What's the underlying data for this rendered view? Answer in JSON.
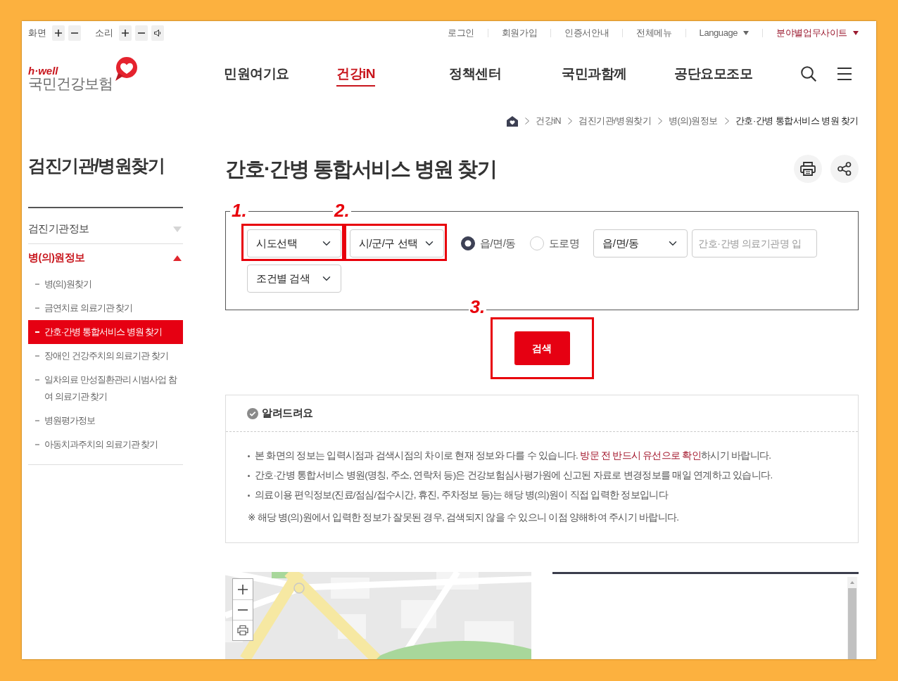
{
  "accessibility_bar": [
    {
      "label": "화면",
      "buttons": [
        {
          "kind": "increase"
        },
        {
          "kind": "decrease"
        }
      ]
    },
    {
      "label": "소리",
      "buttons": [
        {
          "kind": "increase"
        },
        {
          "kind": "decrease"
        },
        {
          "kind": "speaker"
        }
      ]
    }
  ],
  "utility_links": [
    {
      "label": "로그인",
      "dropdown": false,
      "emphasized": false
    },
    {
      "label": "회원가입",
      "dropdown": false,
      "emphasized": false
    },
    {
      "label": "인증서안내",
      "dropdown": false,
      "emphasized": false
    },
    {
      "label": "전체메뉴",
      "dropdown": false,
      "emphasized": false
    },
    {
      "label": "Language",
      "dropdown": true,
      "emphasized": false
    },
    {
      "label": "분야별업무사이트",
      "dropdown": true,
      "emphasized": true
    }
  ],
  "logo": {
    "tagline": "h·well",
    "name": "국민건강보험"
  },
  "nav": [
    {
      "label": "민원여기요",
      "selected": false
    },
    {
      "label": "건강iN",
      "selected": true
    },
    {
      "label": "정책센터",
      "selected": false
    },
    {
      "label": "국민과함께",
      "selected": false
    },
    {
      "label": "공단요모조모",
      "selected": false
    }
  ],
  "breadcrumb": [
    {
      "label": "건강iN",
      "current": false
    },
    {
      "label": "검진기관/병원찾기",
      "current": false
    },
    {
      "label": "병(의)원정보",
      "current": false
    },
    {
      "label": "간호·간병 통합서비스 병원 찾기",
      "current": true
    }
  ],
  "sidebar": {
    "title": "검진기관/병원찾기",
    "sections": [
      {
        "label": "검진기관정보",
        "expanded": false
      },
      {
        "label": "병(의)원정보",
        "expanded": true,
        "children": [
          {
            "label": "병(의)원찾기",
            "selected": false
          },
          {
            "label": "금연치료 의료기관 찾기",
            "selected": false
          },
          {
            "label": "간호·간병 통합서비스 병원 찾기",
            "selected": true
          },
          {
            "label": "장애인 건강주치의 의료기관 찾기",
            "selected": false
          },
          {
            "label": "일차의료 만성질환관리 시범사업 참여 의료기관 찾기",
            "selected": false
          },
          {
            "label": "병원평가정보",
            "selected": false
          },
          {
            "label": "아동치과주치의 의료기관 찾기",
            "selected": false
          }
        ]
      }
    ]
  },
  "page": {
    "title": "간호·간병 통합서비스 병원 찾기"
  },
  "search": {
    "filters": [
      {
        "kind": "select",
        "value": "시도선택",
        "step": "1."
      },
      {
        "kind": "select",
        "value": "시/군/구 선택",
        "step": "2."
      },
      {
        "kind": "radio",
        "label": "읍/면/동",
        "selected": true
      },
      {
        "kind": "radio",
        "label": "도로명",
        "selected": false
      },
      {
        "kind": "select",
        "value": "읍/면/동"
      },
      {
        "kind": "input",
        "placeholder": "간호·간병 의료기관명 입"
      },
      {
        "kind": "select",
        "value": "조건별 검색"
      }
    ],
    "button": {
      "label": "검색",
      "step": "3."
    }
  },
  "notice": {
    "title": "알려드려요",
    "items": [
      {
        "kind": "bullet",
        "parts": [
          {
            "text": "본 화면의 정보는 입력시점과 검색시점의 차이로 현재 정보와 다를 수 있습니다. ",
            "emphasis": false
          },
          {
            "text": "방문 전 반드시 유선으로 확인",
            "emphasis": true
          },
          {
            "text": "하시기 바랍니다.",
            "emphasis": false
          }
        ]
      },
      {
        "kind": "bullet",
        "parts": [
          {
            "text": "간호·간병 통합서비스 병원(명칭, 주소, 연락처 등)은 건강보험심사평가원에 신고된 자료로 변경정보를 매일 연계하고 있습니다.",
            "emphasis": false
          }
        ]
      },
      {
        "kind": "bullet",
        "parts": [
          {
            "text": "의료이용 편익정보(진료/점심/접수시간, 휴진, 주차정보 등)는 해당 병(의)원이 직접 입력한 정보입니다",
            "emphasis": false
          }
        ]
      },
      {
        "kind": "note",
        "parts": [
          {
            "text": "※ 해당 병(의)원에서 입력한 정보가 잘못된 경우, 검색되지 않을 수 있으니 이점 양해하여 주시기 바랍니다.",
            "emphasis": false
          }
        ]
      }
    ]
  }
}
